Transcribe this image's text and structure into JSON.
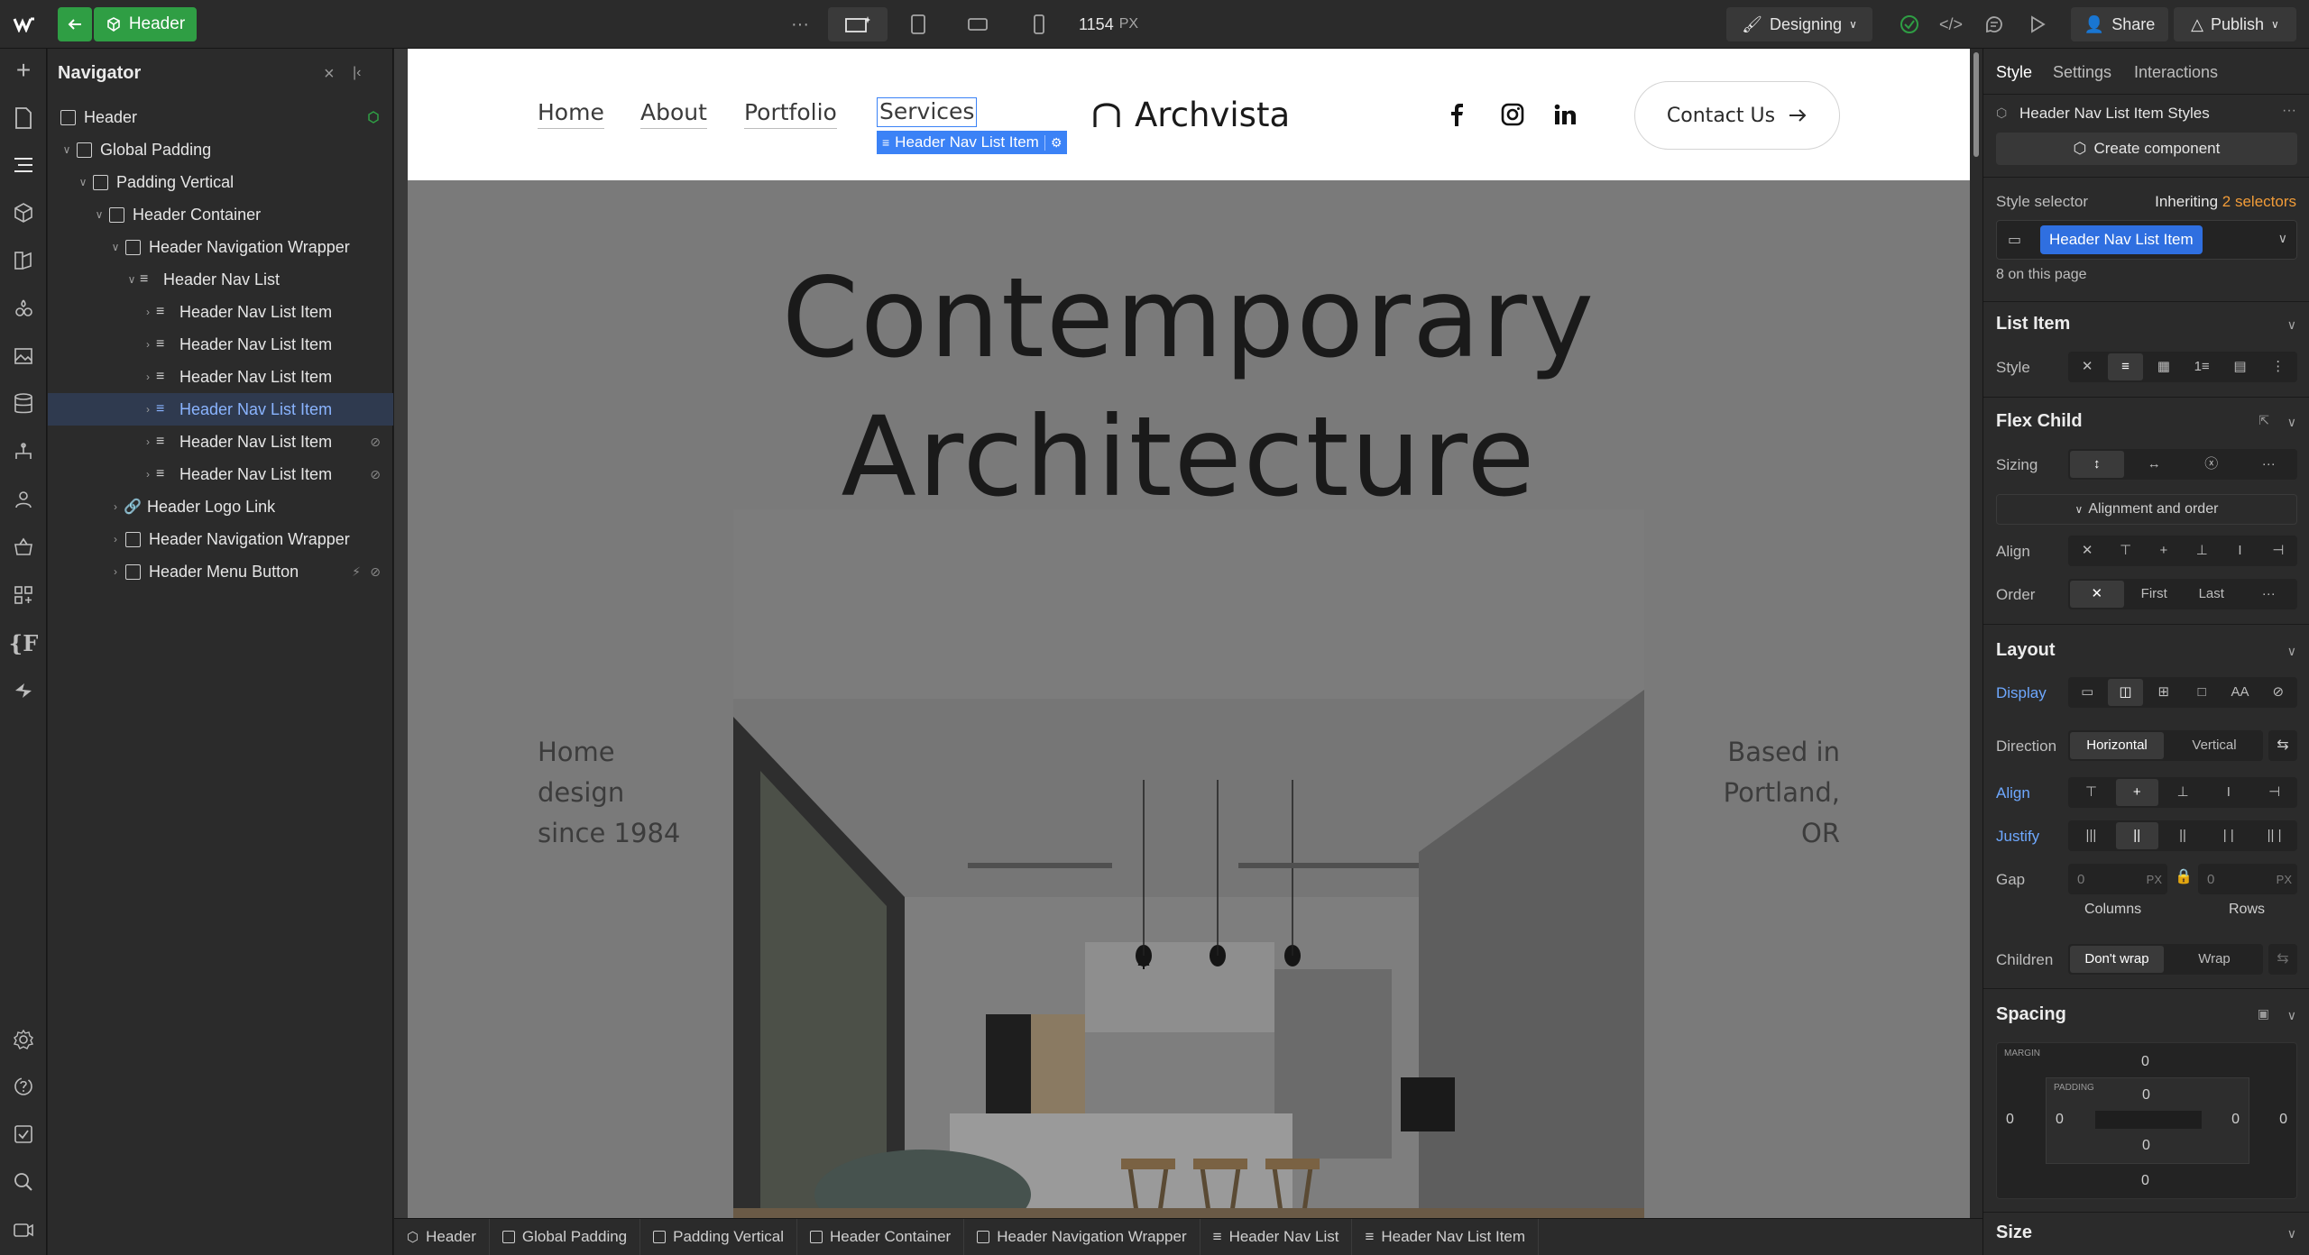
{
  "topbar": {
    "back_icon": "arrow-left-icon",
    "component_label": "Header",
    "more": "···",
    "width_value": "1154",
    "width_unit": "PX",
    "mode_label": "Designing",
    "share_label": "Share",
    "publish_label": "Publish"
  },
  "navigator": {
    "title": "Navigator",
    "rows": [
      {
        "label": "Header",
        "indent": 0
      },
      {
        "label": "Global Padding",
        "indent": 1
      },
      {
        "label": "Padding Vertical",
        "indent": 2
      },
      {
        "label": "Header Container",
        "indent": 3
      },
      {
        "label": "Header Navigation Wrapper",
        "indent": 4
      },
      {
        "label": "Header Nav List",
        "indent": 5
      },
      {
        "label": "Header Nav List Item",
        "indent": 6
      },
      {
        "label": "Header Nav List Item",
        "indent": 6
      },
      {
        "label": "Header Nav List Item",
        "indent": 6
      },
      {
        "label": "Header Nav List Item",
        "indent": 6
      },
      {
        "label": "Header Nav List Item",
        "indent": 6
      },
      {
        "label": "Header Nav List Item",
        "indent": 6
      },
      {
        "label": "Header Logo Link",
        "indent": 4
      },
      {
        "label": "Header Navigation Wrapper",
        "indent": 4
      },
      {
        "label": "Header Menu Button",
        "indent": 4
      }
    ]
  },
  "canvas": {
    "nav": [
      "Home",
      "About",
      "Portfolio",
      "Services"
    ],
    "selected_tag": "Header Nav List Item",
    "logo": "Archvista",
    "contact_label": "Contact Us",
    "hero_line1": "Contemporary",
    "hero_line2": "Architecture",
    "left_text": [
      "Home",
      "design",
      "since 1984"
    ],
    "right_text": [
      "Based in",
      "Portland,",
      "OR"
    ]
  },
  "panel": {
    "tabs": [
      "Style",
      "Settings",
      "Interactions"
    ],
    "styles_title": "Header Nav List Item Styles",
    "create_component": "Create component",
    "style_selector_label": "Style selector",
    "inheriting_label": "Inheriting",
    "inheriting_count": "2 selectors",
    "selector_chip": "Header Nav List Item",
    "on_page": "8 on this page",
    "list_item_title": "List Item",
    "style_label": "Style",
    "flex_child_title": "Flex Child",
    "sizing_label": "Sizing",
    "alignment_order": "Alignment and order",
    "align_label": "Align",
    "order_label": "Order",
    "order_first": "First",
    "order_last": "Last",
    "layout_title": "Layout",
    "display_label": "Display",
    "direction_label": "Direction",
    "direction_h": "Horizontal",
    "direction_v": "Vertical",
    "align2_label": "Align",
    "justify_label": "Justify",
    "gap_label": "Gap",
    "gap_col": "0",
    "gap_row": "0",
    "px": "PX",
    "columns_label": "Columns",
    "rows_label": "Rows",
    "children_label": "Children",
    "dont_wrap": "Don't wrap",
    "wrap": "Wrap",
    "spacing_title": "Spacing",
    "margin_label": "MARGIN",
    "padding_label": "PADDING",
    "margin_top": "0",
    "margin_right": "0",
    "margin_bottom": "0",
    "margin_left": "0",
    "padding_top": "0",
    "padding_right": "0",
    "padding_bottom": "0",
    "padding_left": "0",
    "size_title": "Size"
  },
  "breadcrumb": [
    "Header",
    "Global Padding",
    "Padding Vertical",
    "Header Container",
    "Header Navigation Wrapper",
    "Header Nav List",
    "Header Nav List Item"
  ],
  "colors": {
    "accent": "#3b82f6",
    "green": "#2f9e44",
    "selected_row": "#2f3a4f"
  }
}
